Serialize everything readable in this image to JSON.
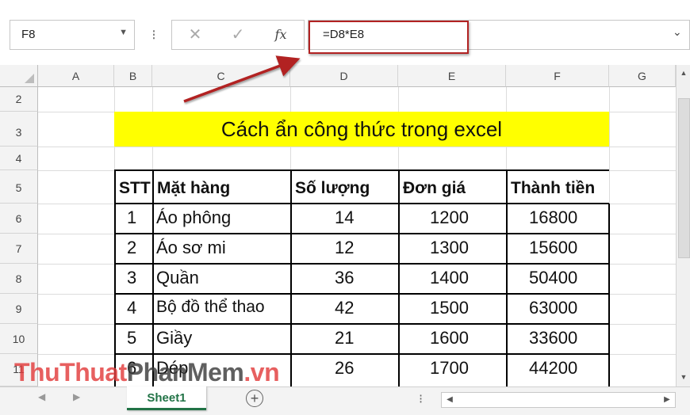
{
  "formula_bar": {
    "name_box": "F8",
    "formula": "=D8*E8",
    "fx_label": "fx"
  },
  "columns": [
    "A",
    "B",
    "C",
    "D",
    "E",
    "F",
    "G"
  ],
  "rows": [
    "2",
    "3",
    "4",
    "5",
    "6",
    "7",
    "8",
    "9",
    "10",
    "11"
  ],
  "title": "Cách ẩn công thức trong excel",
  "table": {
    "headers": [
      "STT",
      "Mặt hàng",
      "Số lượng",
      "Đơn giá",
      "Thành tiền"
    ],
    "rows": [
      [
        "1",
        "Áo phông",
        "14",
        "1200",
        "16800"
      ],
      [
        "2",
        "Áo sơ mi",
        "12",
        "1300",
        "15600"
      ],
      [
        "3",
        "Quần",
        "36",
        "1400",
        "50400"
      ],
      [
        "4",
        "Bộ đồ thể thao",
        "42",
        "1500",
        "63000"
      ],
      [
        "5",
        "Giầy",
        "21",
        "1600",
        "33600"
      ],
      [
        "6",
        "Dép",
        "26",
        "1700",
        "44200"
      ]
    ]
  },
  "sheet_tab": "Sheet1",
  "watermark": {
    "part1": "ThuThuat",
    "part2": "PhanMem",
    "part3": ".vn"
  },
  "colors": {
    "title_fill": "#ffff00",
    "highlight": "#b22222",
    "sheet_tab_text": "#217346"
  }
}
